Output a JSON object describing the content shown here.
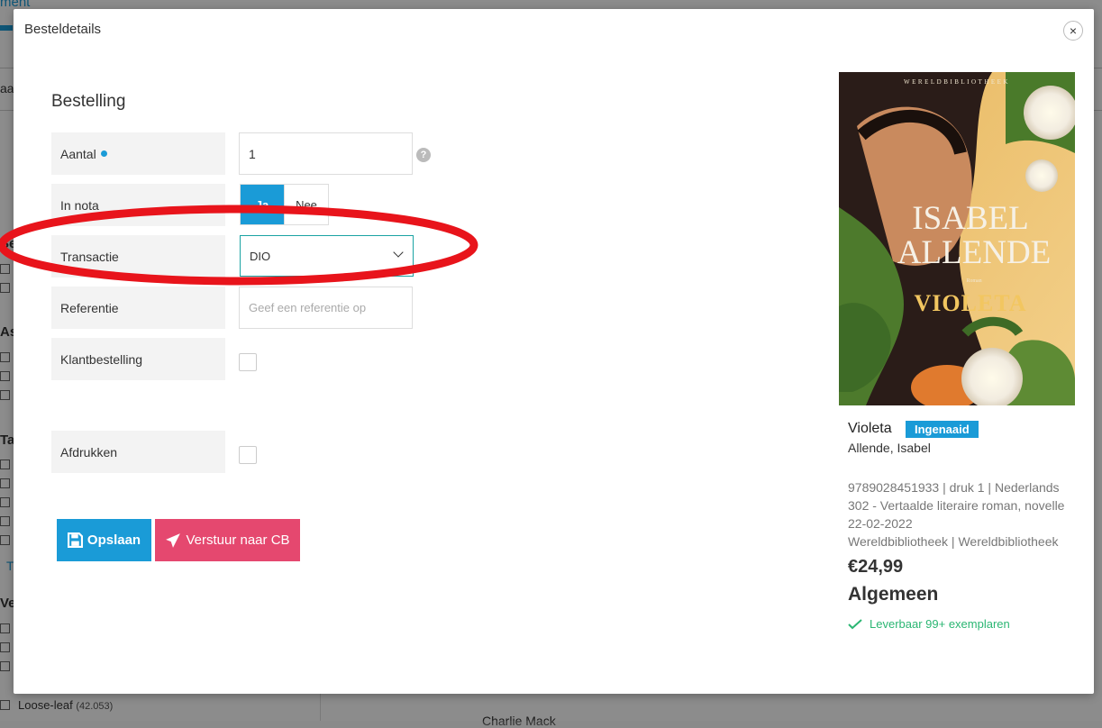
{
  "background": {
    "link_text": "ment",
    "left_letters": [
      "aa",
      "Se",
      "As",
      "Ta",
      "T",
      "Ve"
    ],
    "bottom_item": "Loose-leaf",
    "bottom_count": "(42.053)",
    "bottom_right_text": "Charlie Mack"
  },
  "modal": {
    "title": "Besteldetails",
    "close_icon": "×",
    "section_title": "Bestelling"
  },
  "form": {
    "aantal": {
      "label": "Aantal",
      "value": "1"
    },
    "in_nota": {
      "label": "In nota",
      "options": [
        "Ja",
        "Nee"
      ],
      "selected": "Ja"
    },
    "transactie": {
      "label": "Transactie",
      "value": "DIO"
    },
    "referentie": {
      "label": "Referentie",
      "placeholder": "Geef een referentie op"
    },
    "klantbestelling": {
      "label": "Klantbestelling",
      "checked": false
    },
    "afdrukken": {
      "label": "Afdrukken",
      "checked": false
    },
    "help_icon": "?"
  },
  "buttons": {
    "save": "Opslaan",
    "send": "Verstuur naar CB"
  },
  "book": {
    "cover_series": "WERELDBIBLIOTHEEK",
    "cover_author_line1": "ISABEL",
    "cover_author_line2": "ALLENDE",
    "cover_genre": "Roman",
    "cover_title": "VIOLETA",
    "title": "Violeta",
    "badge": "Ingenaaid",
    "author": "Allende, Isabel",
    "meta_line1": "9789028451933 | druk 1 | Nederlands",
    "meta_line2": "302 - Vertaalde literaire roman, novelle",
    "meta_line3": "22-02-2022",
    "meta_line4": "Wereldbibliotheek | Wereldbibliotheek",
    "price": "€24,99",
    "category": "Algemeen",
    "stock": "Leverbaar 99+ exemplaren"
  },
  "colors": {
    "primary": "#1a9bd7",
    "send": "#e5486f",
    "success": "#2bb673",
    "annotation": "#e8141b"
  }
}
